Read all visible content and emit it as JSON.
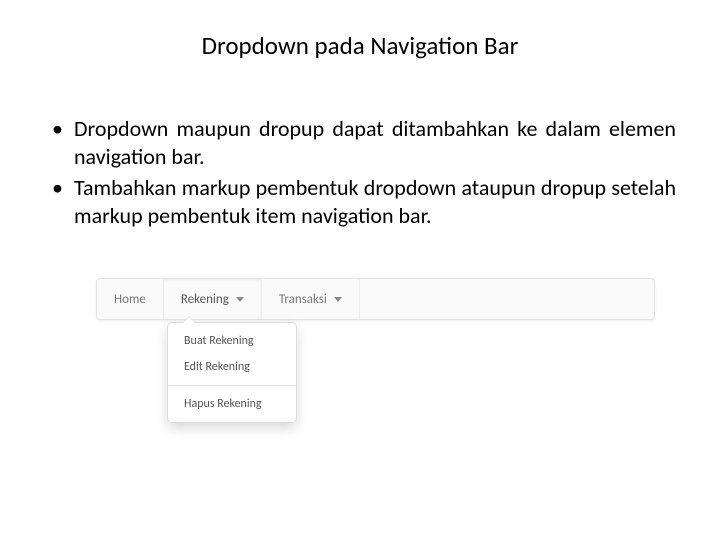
{
  "title": "Dropdown pada Navigation Bar",
  "bullets": [
    "Dropdown maupun dropup dapat ditambahkan ke dalam elemen navigation bar.",
    "Tambahkan markup pembentuk dropdown ataupun dropup setelah markup pembentuk item navigation bar."
  ],
  "navbar": {
    "items": [
      {
        "label": "Home",
        "has_caret": false
      },
      {
        "label": "Rekening",
        "has_caret": true
      },
      {
        "label": "Transaksi",
        "has_caret": true
      }
    ]
  },
  "dropdown": {
    "items": [
      "Buat Rekening",
      "Edit Rekening"
    ],
    "after_divider": [
      "Hapus Rekening"
    ]
  }
}
